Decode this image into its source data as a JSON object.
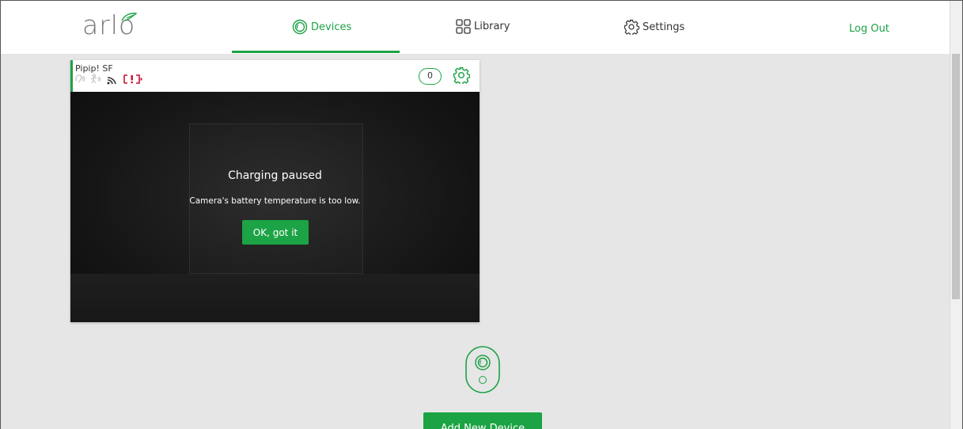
{
  "header": {
    "logo_text": "arlo",
    "nav": {
      "devices": "Devices",
      "library": "Library",
      "settings": "Settings",
      "logout": "Log Out"
    },
    "active_tab": "devices"
  },
  "camera_card": {
    "name": "Pipip! SF",
    "event_count": "0",
    "overlay": {
      "title": "Charging paused",
      "message": "Camera's battery temperature is too low.",
      "button_label": "OK, got it"
    },
    "status_icons": [
      "audio-icon",
      "motion-icon",
      "wifi-signal-icon",
      "battery-alert-icon"
    ]
  },
  "add_device": {
    "button_label": "Add New Device"
  },
  "colors": {
    "accent": "#1ca345",
    "alert": "#c8102e",
    "background": "#e6e6e6"
  }
}
